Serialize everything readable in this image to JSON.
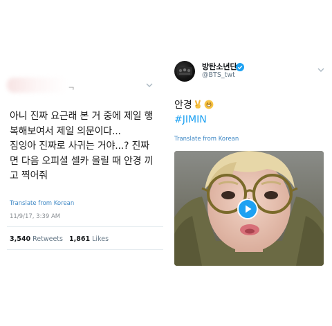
{
  "left_tweet": {
    "text": "아니 진짜 요근래 본 거 중에 제일 행\n복해보여서 제일 의문이다...\n짐잉아 진짜로 사귀는 거야...? 진짜\n면 다음 오피셜 셀카 올릴 때 안경 끼\n고 찍어줘",
    "translate_label": "Translate from Korean",
    "timestamp": "11/9/17, 3:39 AM",
    "retweets_count": "3,540",
    "retweets_label": "Retweets",
    "likes_count": "1,861",
    "likes_label": "Likes"
  },
  "right_tweet": {
    "account_name": "방탄소년단",
    "handle": "@BTS_twt",
    "text": "안경",
    "emojis": [
      "victory-hand",
      "grinning-face"
    ],
    "hashtag": "#JIMIN",
    "translate_label": "Translate from Korean",
    "media": "video"
  },
  "colors": {
    "link": "#3d87c4",
    "hashtag": "#1da1f2",
    "muted": "#657786",
    "verified": "#1da1f2"
  }
}
